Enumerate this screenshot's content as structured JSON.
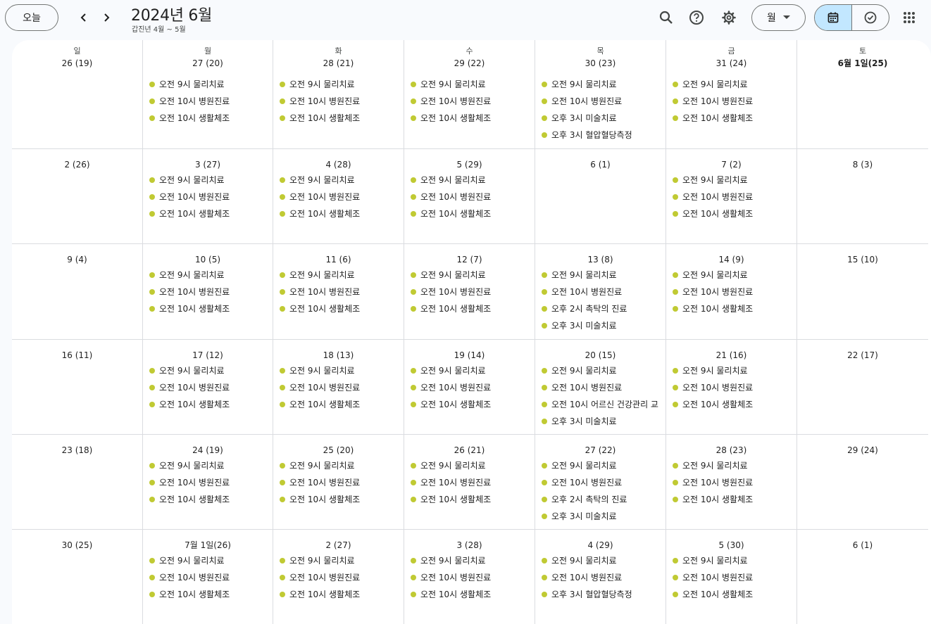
{
  "header": {
    "today_label": "오늘",
    "title": "2024년 6월",
    "subtitle": "갑진년 4월 ~ 5월",
    "view_label": "월",
    "icons": [
      "chevron-left-icon",
      "chevron-right-icon",
      "search-icon",
      "help-icon",
      "settings-icon",
      "dropdown-arrow-icon",
      "calendar-icon",
      "tasks-icon",
      "apps-grid-icon"
    ]
  },
  "colors": {
    "event_dot": "#c0ca33",
    "toggle_active": "#c2e7ff"
  },
  "weekdays": [
    "일",
    "월",
    "화",
    "수",
    "목",
    "금",
    "토"
  ],
  "weeks": [
    [
      {
        "date": "26  (19)",
        "events": []
      },
      {
        "date": "27 (20)",
        "events": [
          "오전 9시 물리치료",
          "오전 10시 병원진료",
          "오전 10시 생활체조"
        ]
      },
      {
        "date": "28 (21)",
        "events": [
          "오전 9시 물리치료",
          "오전 10시 병원진료",
          "오전 10시 생활체조"
        ]
      },
      {
        "date": "29 (22)",
        "events": [
          "오전 9시 물리치료",
          "오전 10시 병원진료",
          "오전 10시 생활체조"
        ]
      },
      {
        "date": "30 (23)",
        "events": [
          "오전 9시 물리치료",
          "오전 10시 병원진료",
          "오후 3시 미술치료",
          "오후 3시 혈압혈당측정"
        ]
      },
      {
        "date": "31 (24)",
        "events": [
          "오전 9시 물리치료",
          "오전 10시 병원진료",
          "오전 10시 생활체조"
        ]
      },
      {
        "date": "6월 1일(25)",
        "bold": true,
        "events": []
      }
    ],
    [
      {
        "date": "2  (26)",
        "events": []
      },
      {
        "date": "3  (27)",
        "events": [
          "오전 9시 물리치료",
          "오전 10시 병원진료",
          "오전 10시 생활체조"
        ]
      },
      {
        "date": "4  (28)",
        "events": [
          "오전 9시 물리치료",
          "오전 10시 병원진료",
          "오전 10시 생활체조"
        ]
      },
      {
        "date": "5  (29)",
        "events": [
          "오전 9시 물리치료",
          "오전 10시 병원진료",
          "오전 10시 생활체조"
        ]
      },
      {
        "date": "6  (1)",
        "events": []
      },
      {
        "date": "7  (2)",
        "events": [
          "오전 9시 물리치료",
          "오전 10시 병원진료",
          "오전 10시 생활체조"
        ]
      },
      {
        "date": "8  (3)",
        "events": []
      }
    ],
    [
      {
        "date": "9  (4)",
        "events": []
      },
      {
        "date": "10 (5)",
        "events": [
          "오전 9시 물리치료",
          "오전 10시 병원진료",
          "오전 10시 생활체조"
        ]
      },
      {
        "date": "11  (6)",
        "events": [
          "오전 9시 물리치료",
          "오전 10시 병원진료",
          "오전 10시 생활체조"
        ]
      },
      {
        "date": "12  (7)",
        "events": [
          "오전 9시 물리치료",
          "오전 10시 병원진료",
          "오전 10시 생활체조"
        ]
      },
      {
        "date": "13  (8)",
        "events": [
          "오전 9시 물리치료",
          "오전 10시 병원진료",
          "오후 2시 촉탁의 진료",
          "오후 3시 미술치료"
        ]
      },
      {
        "date": "14  (9)",
        "events": [
          "오전 9시 물리치료",
          "오전 10시 병원진료",
          "오전 10시 생활체조"
        ]
      },
      {
        "date": "15  (10)",
        "events": []
      }
    ],
    [
      {
        "date": "16  (11)",
        "events": []
      },
      {
        "date": "17  (12)",
        "events": [
          "오전 9시 물리치료",
          "오전 10시 병원진료",
          "오전 10시 생활체조"
        ]
      },
      {
        "date": "18  (13)",
        "events": [
          "오전 9시 물리치료",
          "오전 10시 병원진료",
          "오전 10시 생활체조"
        ]
      },
      {
        "date": "19  (14)",
        "events": [
          "오전 9시 물리치료",
          "오전 10시 병원진료",
          "오전 10시 생활체조"
        ]
      },
      {
        "date": "20  (15)",
        "events": [
          "오전 9시 물리치료",
          "오전 10시 병원진료",
          "오전 10시 어르신 건강관리 교",
          "오후 3시 미술치료"
        ]
      },
      {
        "date": "21  (16)",
        "events": [
          "오전 9시 물리치료",
          "오전 10시 병원진료",
          "오전 10시 생활체조"
        ]
      },
      {
        "date": "22  (17)",
        "events": []
      }
    ],
    [
      {
        "date": "23  (18)",
        "events": []
      },
      {
        "date": "24  (19)",
        "events": [
          "오전 9시 물리치료",
          "오전 10시 병원진료",
          "오전 10시 생활체조"
        ]
      },
      {
        "date": "25 (20)",
        "events": [
          "오전 9시 물리치료",
          "오전 10시 병원진료",
          "오전 10시 생활체조"
        ]
      },
      {
        "date": "26  (21)",
        "events": [
          "오전 9시 물리치료",
          "오전 10시 병원진료",
          "오전 10시 생활체조"
        ]
      },
      {
        "date": "27  (22)",
        "events": [
          "오전 9시 물리치료",
          "오전 10시 병원진료",
          "오후 2시 촉탁의 진료",
          "오후 3시 미술치료"
        ]
      },
      {
        "date": "28  (23)",
        "events": [
          "오전 9시 물리치료",
          "오전 10시 병원진료",
          "오전 10시 생활체조"
        ]
      },
      {
        "date": "29  (24)",
        "events": []
      }
    ],
    [
      {
        "date": "30  (25)",
        "events": []
      },
      {
        "date": "7월 1일(26)",
        "events": [
          "오전 9시 물리치료",
          "오전 10시 병원진료",
          "오전 10시 생활체조"
        ]
      },
      {
        "date": "2  (27)",
        "events": [
          "오전 9시 물리치료",
          "오전 10시 병원진료",
          "오전 10시 생활체조"
        ]
      },
      {
        "date": "3  (28)",
        "events": [
          "오전 9시 물리치료",
          "오전 10시 병원진료",
          "오전 10시 생활체조"
        ]
      },
      {
        "date": "4  (29)",
        "events": [
          "오전 9시 물리치료",
          "오전 10시 병원진료",
          "오후 3시 혈압혈당측정"
        ]
      },
      {
        "date": "5  (30)",
        "events": [
          "오전 9시 물리치료",
          "오전 10시 병원진료",
          "오전 10시 생활체조"
        ]
      },
      {
        "date": "6  (1)",
        "events": []
      }
    ]
  ]
}
